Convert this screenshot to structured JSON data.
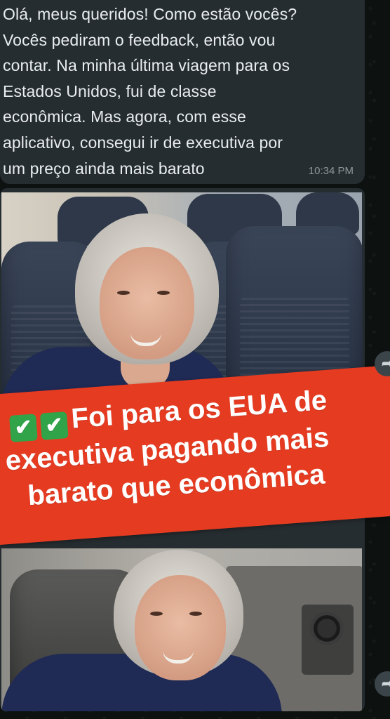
{
  "message": {
    "text": "Olá, meus queridos! Como estão vocês?\nVocês pediram o feedback, então vou\ncontar. Na minha última viagem para os\nEstados Unidos, fui de classe\neconômica. Mas agora, com esse\naplicativo, consegui ir de executiva por\num preço ainda mais barato",
    "time": "10:34 PM"
  },
  "image_message": {
    "banner": {
      "line1": "Foi para os EUA de",
      "line2": "executiva pagando mais",
      "line3": "barato que econômica",
      "emoji": "✔",
      "banner_color": "#e53b21"
    },
    "forward_icon": "forward-arrow-icon"
  },
  "colors": {
    "bubble": "#262d31",
    "text": "#e9edef",
    "time": "#8b969b"
  }
}
